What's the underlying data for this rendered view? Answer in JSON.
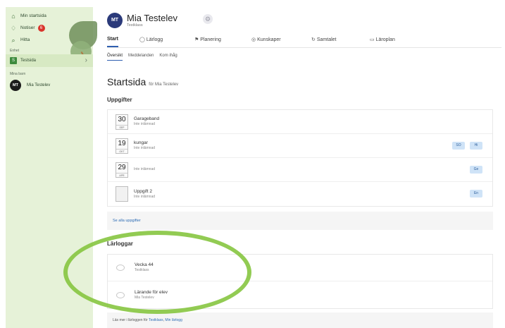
{
  "sidebar": {
    "nav": [
      {
        "icon": "home-icon",
        "glyph": "⌂",
        "label": "Min startsida"
      },
      {
        "icon": "bell-icon",
        "glyph": "🔔",
        "label": "Notiser",
        "badge": "6"
      },
      {
        "icon": "search-icon",
        "glyph": "⌕",
        "label": "Hitta"
      }
    ],
    "school_section": "Enhet",
    "school": {
      "badge": "S",
      "label": "Testsida"
    },
    "children_section": "Mina barn",
    "child": {
      "initials": "MT",
      "name": "Mia Testelev"
    }
  },
  "header": {
    "initials": "MT",
    "name": "Mia Testelev",
    "school": "Testklass"
  },
  "tabs": [
    {
      "label": "Start",
      "glyph": ""
    },
    {
      "label": "Lärlogg",
      "glyph": "◯"
    },
    {
      "label": "Planering",
      "glyph": "⚑"
    },
    {
      "label": "Kunskaper",
      "glyph": "◎"
    },
    {
      "label": "Samtalet",
      "glyph": "↻"
    },
    {
      "label": "Läroplan",
      "glyph": "▭"
    }
  ],
  "subtabs": [
    "Översikt",
    "Meddelanden",
    "Kom ihåg"
  ],
  "page": {
    "title": "Startsida",
    "for": "för Mia Testelev"
  },
  "tasks_heading": "Uppgifter",
  "tasks": [
    {
      "day": "30",
      "month": "SEP",
      "title": "Garageband",
      "status": "Inte inlämnad",
      "tags": []
    },
    {
      "day": "19",
      "month": "OKT",
      "title": "kungar",
      "status": "Inte inlämnad",
      "tags": [
        "SO",
        "Hi"
      ]
    },
    {
      "day": "29",
      "month": "APR",
      "title": "",
      "status": "Inte inlämnad",
      "tags": [
        "Ge"
      ]
    },
    {
      "day": "",
      "month": "",
      "title": "Uppgift 2",
      "status": "Inte inlämnad",
      "tags": [
        "En"
      ]
    }
  ],
  "tasks_link": "Se alla uppgifter",
  "logs_heading": "Lärloggar",
  "logs": [
    {
      "title": "Vecka 44",
      "sub": "Testklass"
    },
    {
      "title": "Lärande för elev",
      "sub": "Mia Testelev"
    }
  ],
  "logs_footer": {
    "text": "Läs mer i lärloggen för",
    "link1": "Testklass",
    "link2": "Min lärlogg"
  }
}
